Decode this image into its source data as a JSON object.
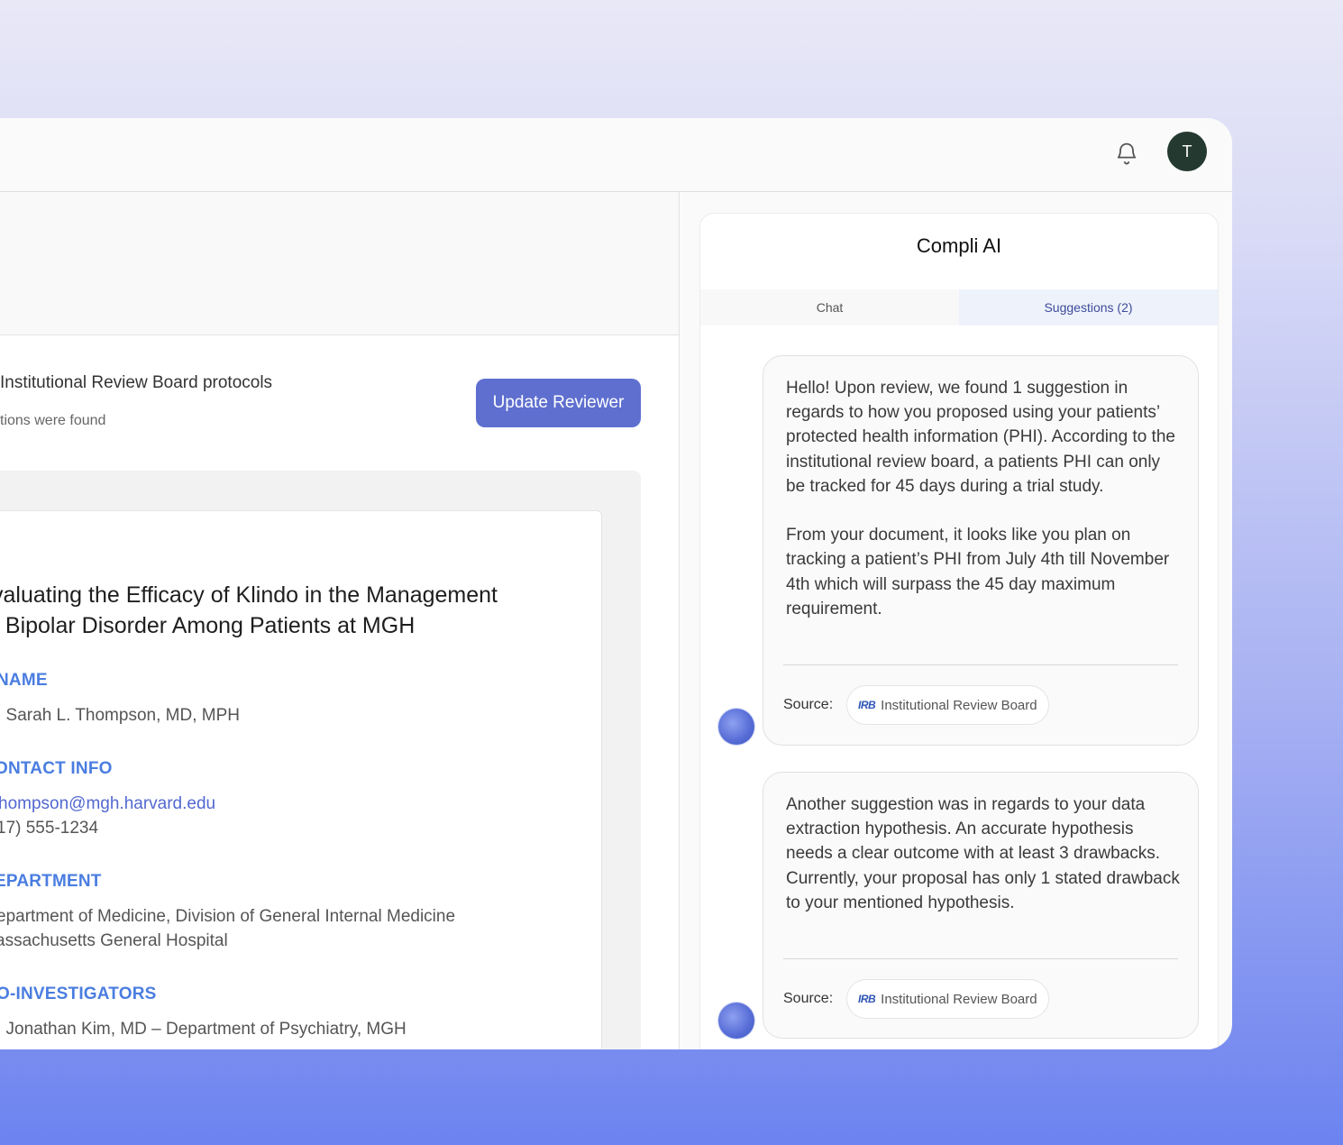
{
  "topbar": {
    "avatar_initial": "T"
  },
  "review": {
    "banner_title": "Institutional Review Board protocols",
    "banner_subtitle": "tions were found",
    "update_button": "Update Reviewer"
  },
  "document": {
    "title_line1": "valuating the Efficacy of Klindo in the Management",
    "title_line2": "f Bipolar Disorder Among Patients at MGH",
    "sections": [
      {
        "heading": "NAME",
        "lines": [
          ". Sarah L. Thompson, MD, MPH"
        ]
      },
      {
        "heading": "ONTACT INFO",
        "lines": [
          "hompson@mgh.harvard.edu",
          "17) 555-1234"
        ]
      },
      {
        "heading": "EPARTMENT",
        "lines": [
          "epartment of Medicine, Division of General Internal Medicine",
          "assachusetts General Hospital"
        ]
      },
      {
        "heading": "O-INVESTIGATORS",
        "lines": [
          ". Jonathan Kim, MD – Department of Psychiatry, MGH"
        ]
      }
    ]
  },
  "assistant": {
    "title": "Compli AI",
    "tabs": [
      {
        "label": "Chat"
      },
      {
        "label": "Suggestions (2)"
      }
    ],
    "messages": [
      {
        "text": "Hello! Upon review, we found 1 suggestion in regards to how you proposed using your patients’ protected health information (PHI). According to the institutional review board, a patients PHI can only be tracked for 45 days during a trial study.\n\nFrom your document, it looks like you plan on tracking a patient’s PHI from July 4th till November 4th which will surpass the 45 day maximum requirement.",
        "source_label": "Source:",
        "source_logo": "IRB",
        "source_name": "Institutional Review Board"
      },
      {
        "text": "Another suggestion was in regards to your data extraction hypothesis. An accurate hypothesis needs a clear outcome with at least 3 drawbacks. Currently, your proposal has only 1 stated drawback to your mentioned hypothesis.",
        "source_label": "Source:",
        "source_logo": "IRB",
        "source_name": "Institutional Review Board"
      }
    ]
  },
  "icons": {
    "bell": "bell-icon",
    "bot": "bot-avatar-icon"
  },
  "colors": {
    "primary": "#5e6fcf",
    "heading_blue": "#4a7de0",
    "avatar_bg": "#24392f"
  }
}
